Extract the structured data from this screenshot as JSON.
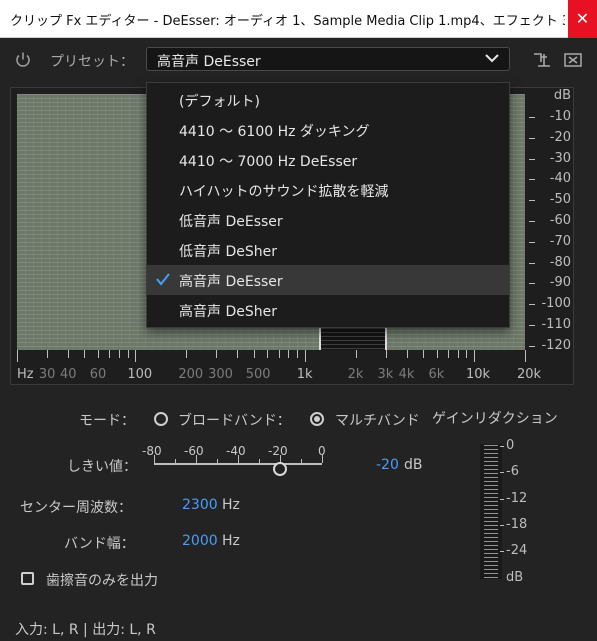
{
  "window": {
    "title": "クリップ Fx エディター - DeEsser: オーディオ 1、Sample Media Clip 1.mp4、エフェクト 3、00:0...",
    "close_glyph": "✕"
  },
  "preset": {
    "label": "プリセット：",
    "selected": "高音声 DeEsser",
    "options": [
      {
        "label": "(デフォルト)",
        "checked": false
      },
      {
        "label": "4410 ～ 6100 Hz ダッキング",
        "checked": false
      },
      {
        "label": "4410 ～ 7000 Hz DeEsser",
        "checked": false
      },
      {
        "label": "ハイハットのサウンド拡散を軽減",
        "checked": false
      },
      {
        "label": "低音声 DeEsser",
        "checked": false
      },
      {
        "label": "低音声 DeSher",
        "checked": false
      },
      {
        "label": "高音声 DeEsser",
        "checked": true
      },
      {
        "label": "高音声 DeSher",
        "checked": false
      }
    ]
  },
  "graph": {
    "y_unit": "dB",
    "y_ticks": [
      "-10",
      "-20",
      "-30",
      "-40",
      "-50",
      "-60",
      "-70",
      "-80",
      "-90",
      "-100",
      "-110",
      "-120"
    ],
    "x_ticks": [
      {
        "label": "Hz",
        "dim": false
      },
      {
        "label": "30",
        "dim": true
      },
      {
        "label": "40",
        "dim": true
      },
      {
        "label": "60",
        "dim": true
      },
      {
        "label": "100",
        "dim": false
      },
      {
        "label": "200",
        "dim": true
      },
      {
        "label": "300",
        "dim": true
      },
      {
        "label": "500",
        "dim": true
      },
      {
        "label": "1k",
        "dim": false
      },
      {
        "label": "2k",
        "dim": true
      },
      {
        "label": "3k",
        "dim": true
      },
      {
        "label": "4k",
        "dim": true
      },
      {
        "label": "6k",
        "dim": true
      },
      {
        "label": "10k",
        "dim": false
      },
      {
        "label": "20k",
        "dim": false
      }
    ]
  },
  "mode": {
    "label": "モード：",
    "broadband": "ブロードバンド：",
    "multiband": "マルチバンド",
    "selected": "multiband"
  },
  "threshold": {
    "label": "しきい値：",
    "scale": [
      "-80",
      "-60",
      "-40",
      "-20",
      "0"
    ],
    "value": "-20",
    "unit": "dB"
  },
  "center_freq": {
    "label": "センター周波数：",
    "value": "2300",
    "unit": "Hz"
  },
  "bandwidth": {
    "label": "バンド幅：",
    "value": "2000",
    "unit": "Hz"
  },
  "output_only": {
    "label": "歯擦音のみを出力",
    "checked": false
  },
  "gain_reduction": {
    "title": "ゲインリダクション",
    "ticks": [
      "0",
      "-6",
      "-12",
      "-18",
      "-24",
      "dB"
    ]
  },
  "footer": {
    "io": "入力: L, R | 出力: L, R"
  },
  "colors": {
    "accent": "#4a9df5",
    "close": "#e81123"
  }
}
